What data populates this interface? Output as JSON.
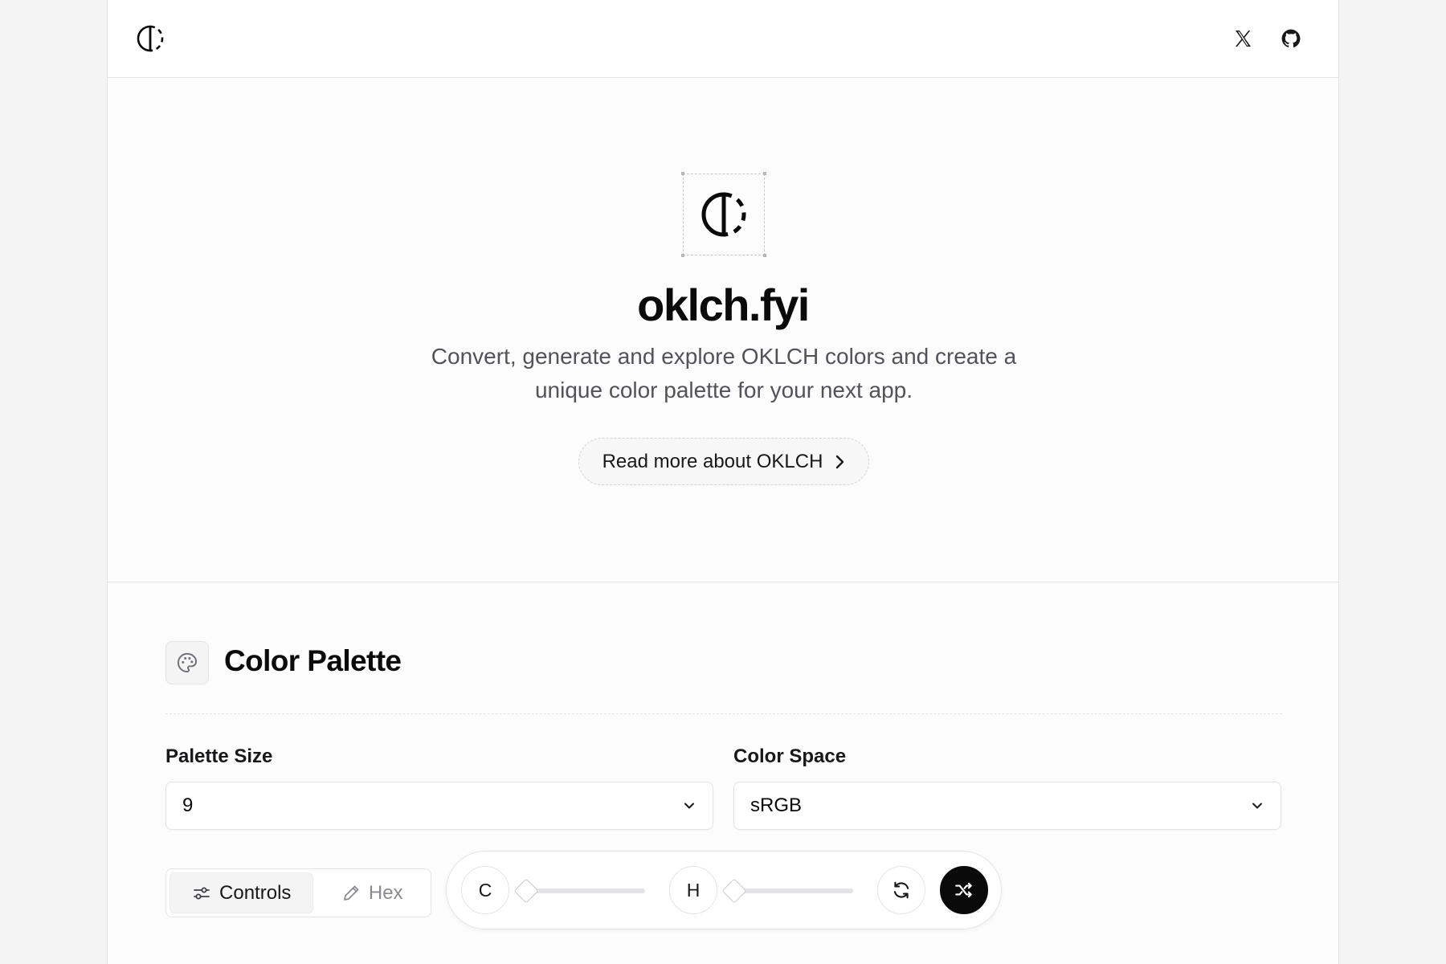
{
  "header": {
    "logo_icon": "half-circle-logo-icon",
    "links": [
      {
        "name": "x-twitter-icon"
      },
      {
        "name": "github-icon"
      }
    ]
  },
  "hero": {
    "title": "oklch.fyi",
    "subtitle": "Convert, generate and explore OKLCH colors and create a unique color palette for your next app.",
    "cta_label": "Read more about OKLCH"
  },
  "palette": {
    "title": "Color Palette",
    "icon": "palette-icon",
    "palette_size": {
      "label": "Palette Size",
      "value": "9"
    },
    "color_space": {
      "label": "Color Space",
      "value": "sRGB"
    },
    "tabs": [
      {
        "label": "Controls",
        "icon": "sliders-icon",
        "active": true
      },
      {
        "label": "Hex",
        "icon": "eyedropper-icon",
        "active": false
      }
    ],
    "controls": {
      "chroma_label": "C",
      "hue_label": "H",
      "chroma_value": 0,
      "hue_value": 0,
      "refresh_icon": "refresh-icon",
      "shuffle_icon": "shuffle-icon"
    }
  },
  "colors": {
    "text": "#0a0a0a",
    "muted": "#52525b",
    "border": "#e4e4e7",
    "dark_button": "#0a0a0a"
  }
}
